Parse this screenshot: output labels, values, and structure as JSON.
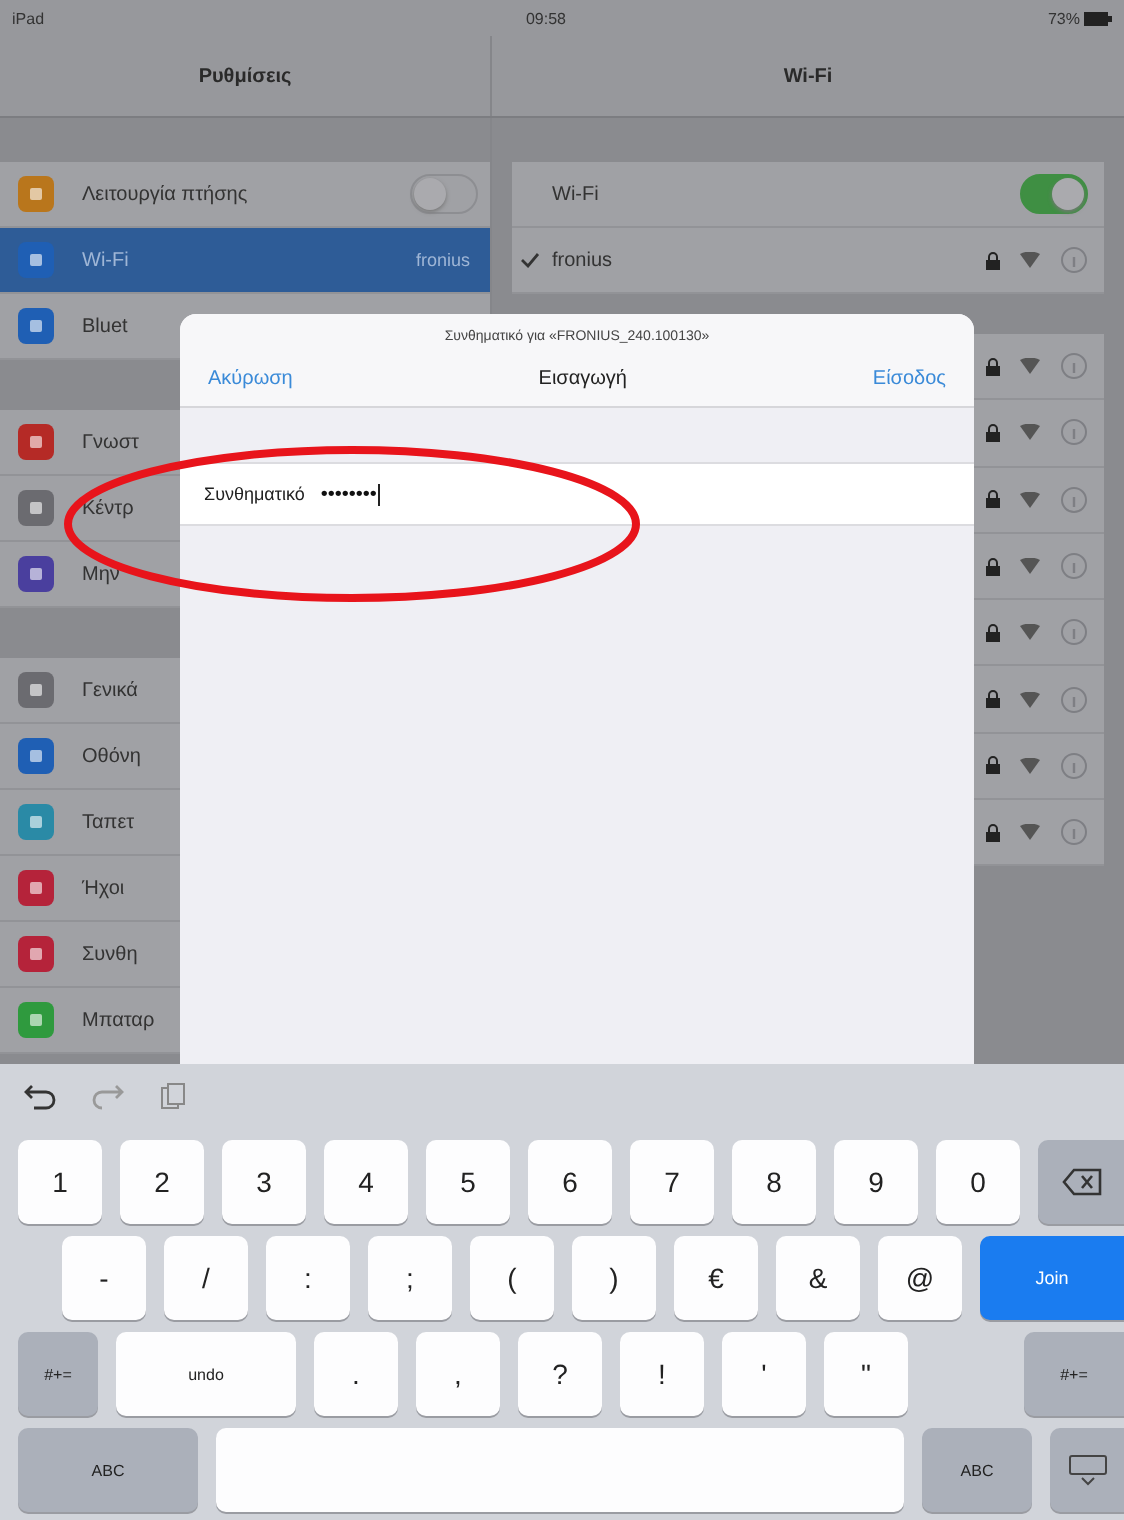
{
  "status_bar": {
    "device": "iPad",
    "time": "09:58",
    "battery": "73%"
  },
  "nav": {
    "left_title": "Ρυθμίσεις",
    "right_title": "Wi-Fi"
  },
  "sidebar": {
    "groups": [
      {
        "items": [
          {
            "label": "Λειτουργία πτήσης",
            "color": "#b9761c",
            "kind": "toggle",
            "on": false,
            "selected": false
          },
          {
            "label": "Wi-Fi",
            "color": "#1f5fb4",
            "kind": "detail",
            "detail": "fronius",
            "selected": true
          },
          {
            "label": "Bluet",
            "color": "#1f5fb4",
            "kind": "plain",
            "selected": false
          }
        ]
      },
      {
        "items": [
          {
            "label": "Γνωστ",
            "color": "#b52a26",
            "kind": "plain",
            "selected": false
          },
          {
            "label": "Κέντρ",
            "color": "#6b6b70",
            "kind": "plain",
            "selected": false
          },
          {
            "label": "Μην",
            "color": "#4a3f9e",
            "kind": "plain",
            "selected": false
          }
        ]
      },
      {
        "items": [
          {
            "label": "Γενικά",
            "color": "#6b6b70",
            "kind": "plain",
            "selected": false
          },
          {
            "label": "Οθόνη",
            "color": "#1f5fb4",
            "kind": "plain",
            "selected": false
          },
          {
            "label": "Ταπετ",
            "color": "#2a8aa6",
            "kind": "plain",
            "selected": false
          },
          {
            "label": "Ήχοι",
            "color": "#b5233a",
            "kind": "plain",
            "selected": false
          },
          {
            "label": "Συνθη",
            "color": "#b5233a",
            "kind": "plain",
            "selected": false
          },
          {
            "label": "Μπαταρ",
            "color": "#2f9a3e",
            "kind": "plain",
            "selected": false
          }
        ]
      }
    ]
  },
  "wifi": {
    "label": "Wi-Fi",
    "on": true,
    "networks": [
      {
        "name": "fronius",
        "connected": true,
        "locked": true
      },
      {
        "locked": true
      },
      {
        "locked": true
      },
      {
        "locked": true
      },
      {
        "locked": true
      },
      {
        "locked": true
      },
      {
        "locked": true
      },
      {
        "locked": true
      },
      {
        "locked": true
      }
    ]
  },
  "dialog": {
    "subtitle": "Συνθηματικό για «FRONIUS_240.100130»",
    "cancel": "Ακύρωση",
    "title": "Εισαγωγή",
    "join": "Είσοδος",
    "field": {
      "label": "Συνθηματικό",
      "value": "••••••••"
    }
  },
  "keyboard": {
    "rows": [
      [
        {
          "label": "1",
          "kind": "key"
        },
        {
          "label": "2",
          "kind": "key"
        },
        {
          "label": "3",
          "kind": "key"
        },
        {
          "label": "4",
          "kind": "key"
        },
        {
          "label": "5",
          "kind": "key"
        },
        {
          "label": "6",
          "kind": "key"
        },
        {
          "label": "7",
          "kind": "key"
        },
        {
          "label": "8",
          "kind": "key"
        },
        {
          "label": "9",
          "kind": "key"
        },
        {
          "label": "0",
          "kind": "key"
        },
        {
          "kind": "backspace"
        }
      ],
      [
        {
          "label": "-",
          "kind": "key"
        },
        {
          "label": "/",
          "kind": "key"
        },
        {
          "label": ":",
          "kind": "key"
        },
        {
          "label": ";",
          "kind": "key"
        },
        {
          "label": "(",
          "kind": "key"
        },
        {
          "label": ")",
          "kind": "key"
        },
        {
          "label": "€",
          "kind": "key"
        },
        {
          "label": "&",
          "kind": "key"
        },
        {
          "label": "@",
          "kind": "key"
        },
        {
          "label": "Join",
          "kind": "primary"
        }
      ],
      [
        {
          "label": "#+=",
          "kind": "modifier"
        },
        {
          "label": "undo",
          "kind": "wide"
        },
        {
          "label": ".",
          "kind": "key"
        },
        {
          "label": ",",
          "kind": "key"
        },
        {
          "label": "?",
          "kind": "key"
        },
        {
          "label": "!",
          "kind": "key"
        },
        {
          "label": "'",
          "kind": "key"
        },
        {
          "label": "\"",
          "kind": "key"
        },
        {
          "kind": "gap"
        },
        {
          "label": "#+=",
          "kind": "modifier"
        }
      ],
      [
        {
          "label": "ABC",
          "kind": "abc"
        },
        {
          "kind": "space"
        },
        {
          "label": "ABC",
          "kind": "abc2"
        },
        {
          "kind": "hide"
        }
      ]
    ]
  }
}
